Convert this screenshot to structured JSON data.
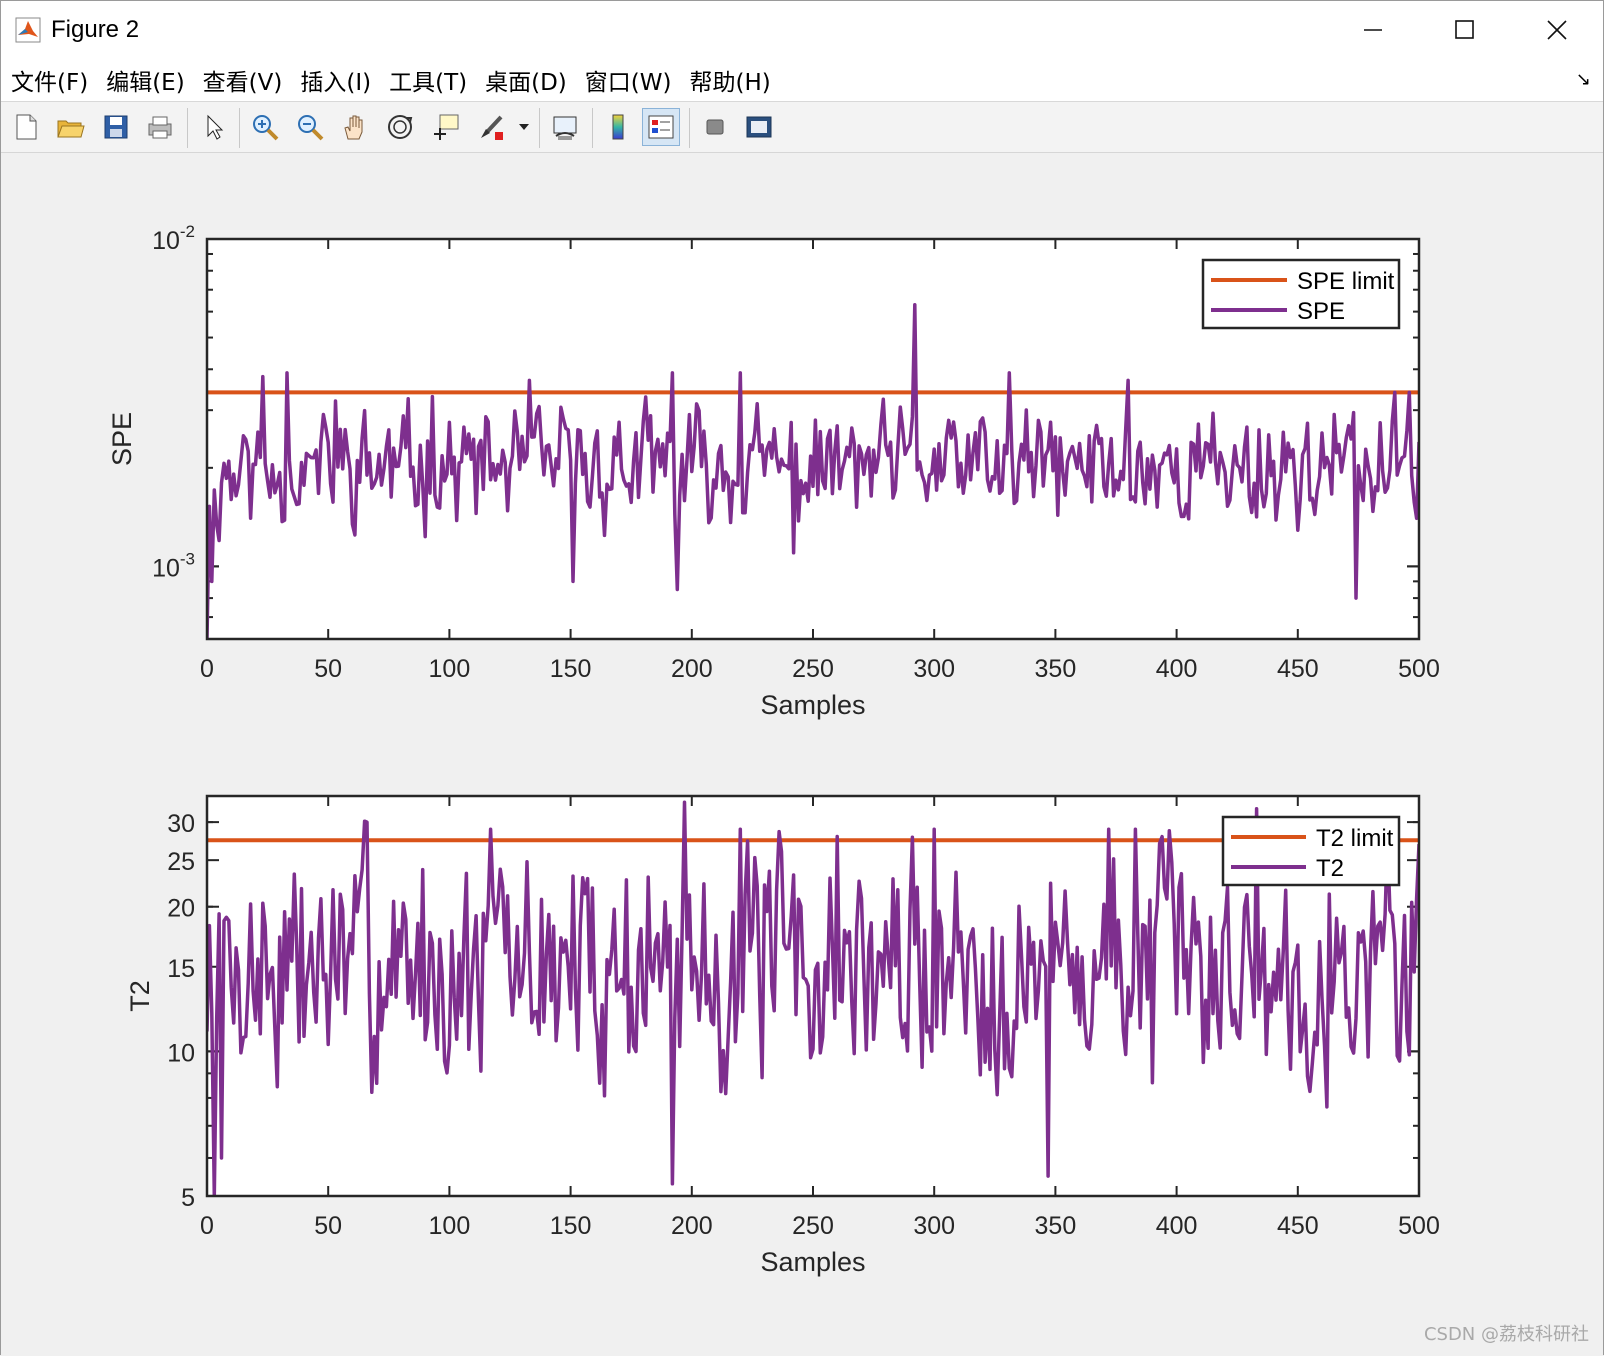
{
  "window": {
    "title": "Figure 2",
    "controls": [
      "minimize",
      "maximize",
      "close"
    ]
  },
  "menu": {
    "items": [
      "文件(F)",
      "编辑(E)",
      "查看(V)",
      "插入(I)",
      "工具(T)",
      "桌面(D)",
      "窗口(W)",
      "帮助(H)"
    ]
  },
  "toolbar": {
    "buttons": [
      "new-figure-icon",
      "open-folder-icon",
      "save-icon",
      "print-icon",
      "pointer-icon",
      "zoom-in-icon",
      "zoom-out-icon",
      "pan-hand-icon",
      "rotate-3d-icon",
      "data-cursor-icon",
      "brush-icon",
      "link-plot-icon",
      "colorbar-icon",
      "legend-icon",
      "hide-plot-tools-icon",
      "show-plot-tools-icon"
    ]
  },
  "colors": {
    "limit": "#D95319",
    "series": "#7E2F8E",
    "axes": "#262626"
  },
  "watermark": "CSDN @荔枝科研社",
  "chart_data": [
    {
      "type": "line",
      "xlabel": "Samples",
      "ylabel": "SPE",
      "xlim": [
        0,
        500
      ],
      "ylim": [
        0.0006,
        0.01
      ],
      "yscale": "log",
      "xticks": [
        0,
        50,
        100,
        150,
        200,
        250,
        300,
        350,
        400,
        450,
        500
      ],
      "yticks": [
        {
          "value": 0.01,
          "base": "10",
          "exp": "-2"
        },
        {
          "value": 0.001,
          "base": "10",
          "exp": "-3"
        }
      ],
      "legend": {
        "location": "top-right",
        "entries": [
          "SPE limit",
          "SPE"
        ]
      },
      "series": [
        {
          "name": "SPE limit",
          "x": [
            0,
            500
          ],
          "values": [
            0.0034,
            0.0034
          ]
        },
        {
          "name": "SPE",
          "style": "noisy",
          "base": 0.002,
          "spread": 0.3,
          "seed": 11,
          "anchors": [
            [
              0,
              0.0006
            ],
            [
              2,
              0.0009
            ],
            [
              5,
              0.0012
            ],
            [
              10,
              0.0016
            ],
            [
              23,
              0.0038
            ],
            [
              33,
              0.0039
            ],
            [
              53,
              0.0032
            ],
            [
              93,
              0.0033
            ],
            [
              133,
              0.0037
            ],
            [
              151,
              0.0009
            ],
            [
              192,
              0.0039
            ],
            [
              194,
              0.00085
            ],
            [
              220,
              0.0039
            ],
            [
              242,
              0.0011
            ],
            [
              292,
              0.0063
            ],
            [
              298,
              0.0019
            ],
            [
              331,
              0.0039
            ],
            [
              380,
              0.0037
            ],
            [
              474,
              0.0008
            ],
            [
              496,
              0.0034
            ],
            [
              500,
              0.0024
            ]
          ]
        }
      ]
    },
    {
      "type": "line",
      "xlabel": "Samples",
      "ylabel": "T2",
      "xlim": [
        0,
        500
      ],
      "ylim": [
        5,
        34
      ],
      "yscale": "log",
      "xticks": [
        0,
        50,
        100,
        150,
        200,
        250,
        300,
        350,
        400,
        450,
        500
      ],
      "yticks": [
        {
          "value": 5,
          "label": "5"
        },
        {
          "value": 10,
          "label": "10"
        },
        {
          "value": 15,
          "label": "15"
        },
        {
          "value": 20,
          "label": "20"
        },
        {
          "value": 25,
          "label": "25"
        },
        {
          "value": 30,
          "label": "30"
        }
      ],
      "legend": {
        "location": "top-right",
        "entries": [
          "T2 limit",
          "T2"
        ]
      },
      "series": [
        {
          "name": "T2 limit",
          "x": [
            0,
            500
          ],
          "values": [
            27.5,
            27.5
          ]
        },
        {
          "name": "T2",
          "style": "noisy",
          "base": 15,
          "spread": 0.42,
          "seed": 7,
          "anchors": [
            [
              0,
              11
            ],
            [
              3,
              5
            ],
            [
              6,
              6
            ],
            [
              66,
              30
            ],
            [
              117,
              29
            ],
            [
              192,
              5.3
            ],
            [
              197,
              33
            ],
            [
              220,
              29
            ],
            [
              260,
              28
            ],
            [
              300,
              29
            ],
            [
              347,
              5.5
            ],
            [
              372,
              29
            ],
            [
              383,
              29
            ],
            [
              433,
              32
            ],
            [
              487,
              28
            ],
            [
              500,
              27
            ]
          ]
        }
      ]
    }
  ]
}
